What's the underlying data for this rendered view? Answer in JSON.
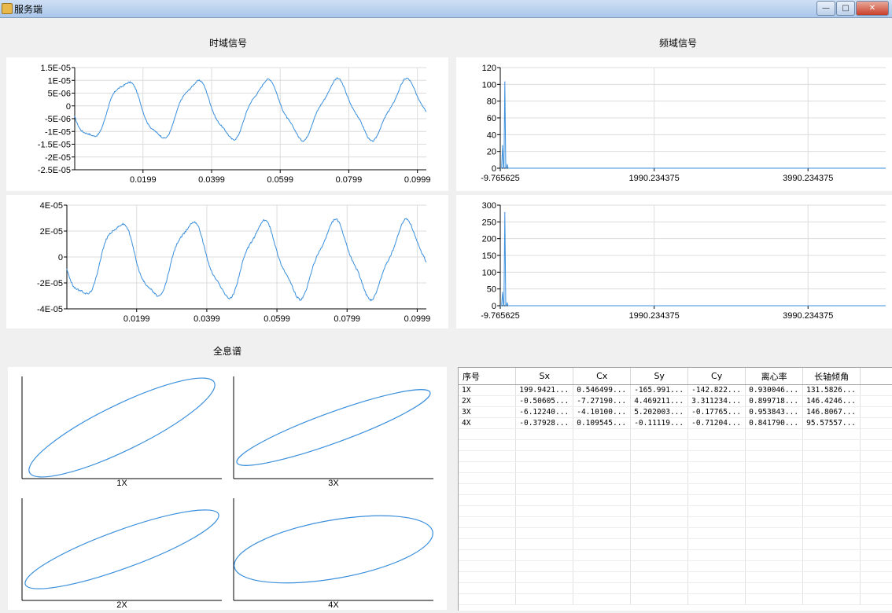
{
  "window": {
    "title": "服务端",
    "minimize_glyph": "—",
    "maximize_glyph": "□",
    "close_glyph": "✕"
  },
  "sections": {
    "time": "时域信号",
    "freq": "频域信号",
    "holo": "全息谱"
  },
  "colors": {
    "signal": "#3a8fdc",
    "grid": "#dcdcdc",
    "axis": "#000000"
  },
  "chart_data": [
    {
      "type": "line",
      "name_hint": "time-top",
      "xlim": [
        0,
        0.1025
      ],
      "xticks": [
        "0.0199",
        "0.0399",
        "0.0599",
        "0.0799",
        "0.0999"
      ],
      "ylim": [
        -2.5e-05,
        1.5e-05
      ],
      "yticks": [
        "1.5E-05",
        "1E-05",
        "5E-06",
        "0",
        "-5E-06",
        "-1E-05",
        "-1.5E-05",
        "-2E-05",
        "-2.5E-05"
      ],
      "cycles": 5,
      "amplitude": 1.1e-05,
      "offset": -1.5e-06
    },
    {
      "type": "line",
      "name_hint": "time-bottom",
      "xlim": [
        0,
        0.1025
      ],
      "xticks": [
        "0.0199",
        "0.0399",
        "0.0599",
        "0.0799",
        "0.0999"
      ],
      "ylim": [
        -4e-05,
        4e-05
      ],
      "yticks": [
        "4E-05",
        "2E-05",
        "0",
        "-2E-05",
        "-4E-05"
      ],
      "cycles": 5,
      "amplitude": 2.8e-05,
      "offset": -2e-06
    },
    {
      "type": "line",
      "name_hint": "freq-top",
      "xlim": [
        -9.765625,
        5000
      ],
      "xticks": [
        "-9.765625",
        "1990.234375",
        "3990.234375"
      ],
      "ylim": [
        0,
        120
      ],
      "yticks": [
        "120",
        "100",
        "80",
        "60",
        "40",
        "20",
        "0"
      ],
      "peaks": [
        {
          "x": 20,
          "y": 27
        },
        {
          "x": 50,
          "y": 103
        },
        {
          "x": 80,
          "y": 4
        }
      ]
    },
    {
      "type": "line",
      "name_hint": "freq-bottom",
      "xlim": [
        -9.765625,
        5000
      ],
      "xticks": [
        "-9.765625",
        "1990.234375",
        "3990.234375"
      ],
      "ylim": [
        0,
        300
      ],
      "yticks": [
        "300",
        "250",
        "200",
        "150",
        "100",
        "50",
        "0"
      ],
      "peaks": [
        {
          "x": 20,
          "y": 40
        },
        {
          "x": 50,
          "y": 278
        },
        {
          "x": 80,
          "y": 8
        }
      ]
    }
  ],
  "holo": [
    {
      "label": "1X",
      "rx": 0.49,
      "ry": 0.36,
      "tilt": -26
    },
    {
      "label": "3X",
      "rx": 0.49,
      "ry": 0.24,
      "tilt": -20
    },
    {
      "label": "2X",
      "rx": 0.49,
      "ry": 0.3,
      "tilt": -20
    },
    {
      "label": "4X",
      "rx": 0.48,
      "ry": 0.46,
      "tilt": -10
    }
  ],
  "table": {
    "headers": [
      "序号",
      "Sx",
      "Cx",
      "Sy",
      "Cy",
      "离心率",
      "长轴倾角"
    ],
    "rows": [
      [
        "1X",
        "199.9421...",
        "0.546499...",
        "-165.991...",
        "-142.822...",
        "0.930046...",
        "131.5826..."
      ],
      [
        "2X",
        "-0.50605...",
        "-7.27190...",
        "4.469211...",
        "3.311234...",
        "0.899718...",
        "146.4246..."
      ],
      [
        "3X",
        "-6.12240...",
        "-4.10100...",
        "5.202003...",
        "-0.17765...",
        "0.953843...",
        "146.8067..."
      ],
      [
        "4X",
        "-0.37928...",
        "0.109545...",
        "-0.11119...",
        "-0.71204...",
        "0.841790...",
        "95.57557..."
      ]
    ]
  }
}
